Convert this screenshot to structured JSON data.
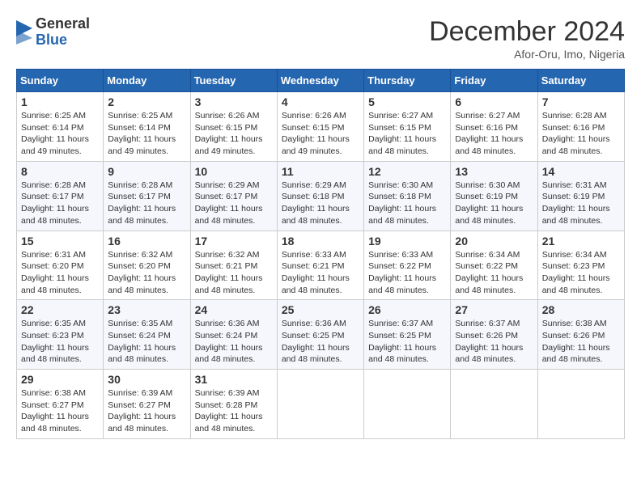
{
  "header": {
    "logo_general": "General",
    "logo_blue": "Blue",
    "month_title": "December 2024",
    "location": "Afor-Oru, Imo, Nigeria"
  },
  "calendar": {
    "days_of_week": [
      "Sunday",
      "Monday",
      "Tuesday",
      "Wednesday",
      "Thursday",
      "Friday",
      "Saturday"
    ],
    "weeks": [
      [
        {
          "day": "1",
          "sunrise": "6:25 AM",
          "sunset": "6:14 PM",
          "daylight": "11 hours and 49 minutes."
        },
        {
          "day": "2",
          "sunrise": "6:25 AM",
          "sunset": "6:14 PM",
          "daylight": "11 hours and 49 minutes."
        },
        {
          "day": "3",
          "sunrise": "6:26 AM",
          "sunset": "6:15 PM",
          "daylight": "11 hours and 49 minutes."
        },
        {
          "day": "4",
          "sunrise": "6:26 AM",
          "sunset": "6:15 PM",
          "daylight": "11 hours and 49 minutes."
        },
        {
          "day": "5",
          "sunrise": "6:27 AM",
          "sunset": "6:15 PM",
          "daylight": "11 hours and 48 minutes."
        },
        {
          "day": "6",
          "sunrise": "6:27 AM",
          "sunset": "6:16 PM",
          "daylight": "11 hours and 48 minutes."
        },
        {
          "day": "7",
          "sunrise": "6:28 AM",
          "sunset": "6:16 PM",
          "daylight": "11 hours and 48 minutes."
        }
      ],
      [
        {
          "day": "8",
          "sunrise": "6:28 AM",
          "sunset": "6:17 PM",
          "daylight": "11 hours and 48 minutes."
        },
        {
          "day": "9",
          "sunrise": "6:28 AM",
          "sunset": "6:17 PM",
          "daylight": "11 hours and 48 minutes."
        },
        {
          "day": "10",
          "sunrise": "6:29 AM",
          "sunset": "6:17 PM",
          "daylight": "11 hours and 48 minutes."
        },
        {
          "day": "11",
          "sunrise": "6:29 AM",
          "sunset": "6:18 PM",
          "daylight": "11 hours and 48 minutes."
        },
        {
          "day": "12",
          "sunrise": "6:30 AM",
          "sunset": "6:18 PM",
          "daylight": "11 hours and 48 minutes."
        },
        {
          "day": "13",
          "sunrise": "6:30 AM",
          "sunset": "6:19 PM",
          "daylight": "11 hours and 48 minutes."
        },
        {
          "day": "14",
          "sunrise": "6:31 AM",
          "sunset": "6:19 PM",
          "daylight": "11 hours and 48 minutes."
        }
      ],
      [
        {
          "day": "15",
          "sunrise": "6:31 AM",
          "sunset": "6:20 PM",
          "daylight": "11 hours and 48 minutes."
        },
        {
          "day": "16",
          "sunrise": "6:32 AM",
          "sunset": "6:20 PM",
          "daylight": "11 hours and 48 minutes."
        },
        {
          "day": "17",
          "sunrise": "6:32 AM",
          "sunset": "6:21 PM",
          "daylight": "11 hours and 48 minutes."
        },
        {
          "day": "18",
          "sunrise": "6:33 AM",
          "sunset": "6:21 PM",
          "daylight": "11 hours and 48 minutes."
        },
        {
          "day": "19",
          "sunrise": "6:33 AM",
          "sunset": "6:22 PM",
          "daylight": "11 hours and 48 minutes."
        },
        {
          "day": "20",
          "sunrise": "6:34 AM",
          "sunset": "6:22 PM",
          "daylight": "11 hours and 48 minutes."
        },
        {
          "day": "21",
          "sunrise": "6:34 AM",
          "sunset": "6:23 PM",
          "daylight": "11 hours and 48 minutes."
        }
      ],
      [
        {
          "day": "22",
          "sunrise": "6:35 AM",
          "sunset": "6:23 PM",
          "daylight": "11 hours and 48 minutes."
        },
        {
          "day": "23",
          "sunrise": "6:35 AM",
          "sunset": "6:24 PM",
          "daylight": "11 hours and 48 minutes."
        },
        {
          "day": "24",
          "sunrise": "6:36 AM",
          "sunset": "6:24 PM",
          "daylight": "11 hours and 48 minutes."
        },
        {
          "day": "25",
          "sunrise": "6:36 AM",
          "sunset": "6:25 PM",
          "daylight": "11 hours and 48 minutes."
        },
        {
          "day": "26",
          "sunrise": "6:37 AM",
          "sunset": "6:25 PM",
          "daylight": "11 hours and 48 minutes."
        },
        {
          "day": "27",
          "sunrise": "6:37 AM",
          "sunset": "6:26 PM",
          "daylight": "11 hours and 48 minutes."
        },
        {
          "day": "28",
          "sunrise": "6:38 AM",
          "sunset": "6:26 PM",
          "daylight": "11 hours and 48 minutes."
        }
      ],
      [
        {
          "day": "29",
          "sunrise": "6:38 AM",
          "sunset": "6:27 PM",
          "daylight": "11 hours and 48 minutes."
        },
        {
          "day": "30",
          "sunrise": "6:39 AM",
          "sunset": "6:27 PM",
          "daylight": "11 hours and 48 minutes."
        },
        {
          "day": "31",
          "sunrise": "6:39 AM",
          "sunset": "6:28 PM",
          "daylight": "11 hours and 48 minutes."
        },
        null,
        null,
        null,
        null
      ]
    ]
  }
}
